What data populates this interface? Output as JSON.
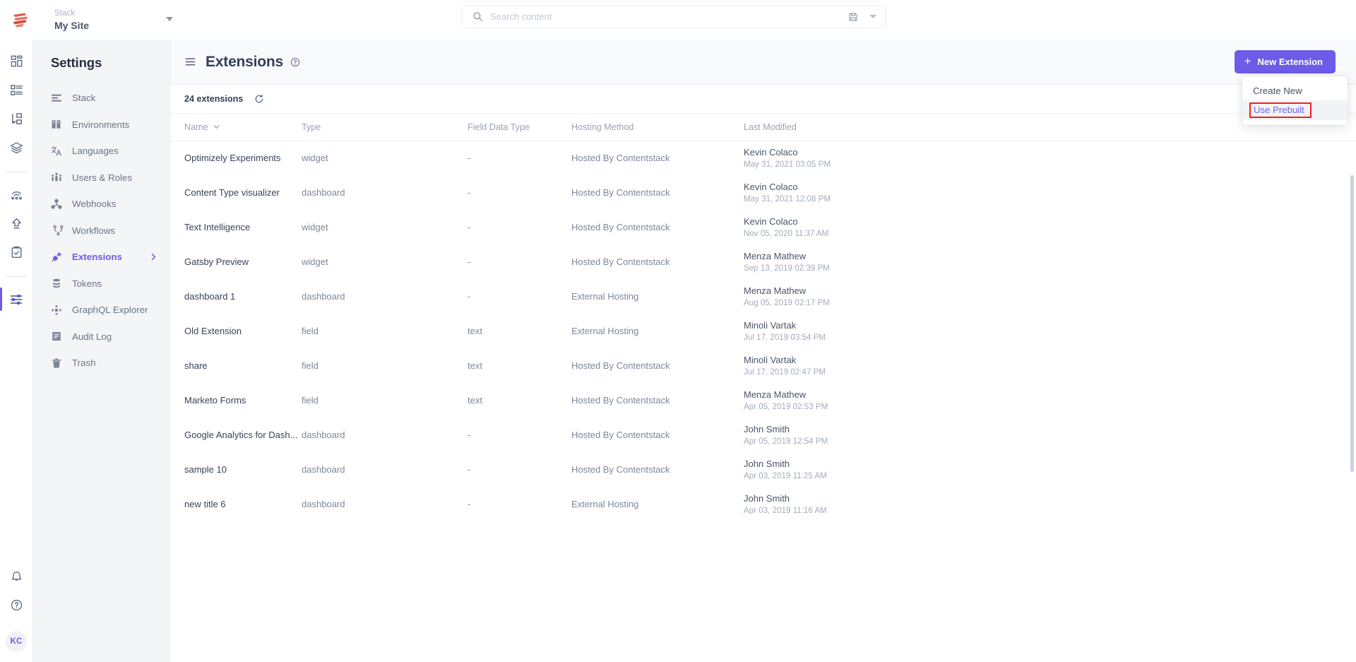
{
  "topbar": {
    "logo_icon": "contentstack-logo-icon",
    "stack_label": "Stack",
    "stack_name": "My Site",
    "search": {
      "placeholder": "Search content",
      "value": "",
      "icon": "search-icon",
      "save_icon": "save-icon",
      "caret_icon": "chevron-down-icon"
    }
  },
  "rail": {
    "items": [
      {
        "name": "dashboard-icon"
      },
      {
        "name": "entries-icon"
      },
      {
        "name": "content-types-icon"
      },
      {
        "name": "assets-icon"
      },
      {
        "name": "releases-icon"
      },
      {
        "name": "publish-queue-icon"
      },
      {
        "name": "bulk-tasks-icon"
      },
      {
        "name": "settings-icon",
        "active": true
      }
    ],
    "bottom": [
      {
        "name": "bell-icon"
      },
      {
        "name": "help-circle-icon"
      }
    ],
    "avatar_initials": "KC"
  },
  "sidebar": {
    "title": "Settings",
    "items": [
      {
        "label": "Stack",
        "icon": "stack-icon",
        "active": false
      },
      {
        "label": "Environments",
        "icon": "environments-icon",
        "active": false
      },
      {
        "label": "Languages",
        "icon": "languages-icon",
        "active": false
      },
      {
        "label": "Users & Roles",
        "icon": "users-roles-icon",
        "active": false
      },
      {
        "label": "Webhooks",
        "icon": "webhooks-icon",
        "active": false
      },
      {
        "label": "Workflows",
        "icon": "workflows-icon",
        "active": false
      },
      {
        "label": "Extensions",
        "icon": "extensions-icon",
        "active": true
      },
      {
        "label": "Tokens",
        "icon": "tokens-icon",
        "active": false
      },
      {
        "label": "GraphQL Explorer",
        "icon": "graphql-icon",
        "active": false
      },
      {
        "label": "Audit Log",
        "icon": "audit-log-icon",
        "active": false
      },
      {
        "label": "Trash",
        "icon": "trash-icon",
        "active": false
      }
    ]
  },
  "page": {
    "menu_icon": "hamburger-icon",
    "title": "Extensions",
    "help_icon": "help-circle-icon",
    "new_button": {
      "label": "New Extension",
      "plus": "+",
      "color": "#6c5ce7"
    },
    "dropdown": {
      "items": [
        {
          "label": "Create New",
          "highlighted": false
        },
        {
          "label": "Use Prebuilt",
          "highlighted": true
        }
      ],
      "highlight_outline_color": "#f2211d"
    }
  },
  "list": {
    "count_text": "24 extensions",
    "refresh_icon": "refresh-icon",
    "columns": [
      {
        "label": "Name",
        "sort_icon": "chevron-down-icon"
      },
      {
        "label": "Type",
        "sort_icon": ""
      },
      {
        "label": "Field Data Type",
        "sort_icon": ""
      },
      {
        "label": "Hosting Method",
        "sort_icon": ""
      },
      {
        "label": "Last Modified",
        "sort_icon": ""
      }
    ],
    "rows": [
      {
        "name": "Optimizely Experiments",
        "type": "widget",
        "field_data_type": "-",
        "hosting_method": "Hosted By Contentstack",
        "modified_by": "Kevin Colaco",
        "modified_at": "May 31, 2021 03:05 PM"
      },
      {
        "name": "Content Type visualizer",
        "type": "dashboard",
        "field_data_type": "-",
        "hosting_method": "Hosted By Contentstack",
        "modified_by": "Kevin Colaco",
        "modified_at": "May 31, 2021 12:08 PM"
      },
      {
        "name": "Text Intelligence",
        "type": "widget",
        "field_data_type": "-",
        "hosting_method": "Hosted By Contentstack",
        "modified_by": "Kevin Colaco",
        "modified_at": "Nov 05, 2020 11:37 AM"
      },
      {
        "name": "Gatsby Preview",
        "type": "widget",
        "field_data_type": "-",
        "hosting_method": "Hosted By Contentstack",
        "modified_by": "Menza Mathew",
        "modified_at": "Sep 13, 2019 02:39 PM"
      },
      {
        "name": "dashboard 1",
        "type": "dashboard",
        "field_data_type": "-",
        "hosting_method": "External Hosting",
        "modified_by": "Menza Mathew",
        "modified_at": "Aug 05, 2019 02:17 PM"
      },
      {
        "name": "Old Extension",
        "type": "field",
        "field_data_type": "text",
        "hosting_method": "External Hosting",
        "modified_by": "Minoli Vartak",
        "modified_at": "Jul 17, 2019 03:54 PM"
      },
      {
        "name": "share",
        "type": "field",
        "field_data_type": "text",
        "hosting_method": "Hosted By Contentstack",
        "modified_by": "Minoli Vartak",
        "modified_at": "Jul 17, 2019 02:47 PM"
      },
      {
        "name": "Marketo Forms",
        "type": "field",
        "field_data_type": "text",
        "hosting_method": "Hosted By Contentstack",
        "modified_by": "Menza Mathew",
        "modified_at": "Apr 05, 2019 02:53 PM"
      },
      {
        "name": "Google Analytics for Dash...",
        "type": "dashboard",
        "field_data_type": "-",
        "hosting_method": "Hosted By Contentstack",
        "modified_by": "John Smith",
        "modified_at": "Apr 05, 2019 12:54 PM"
      },
      {
        "name": "sample 10",
        "type": "dashboard",
        "field_data_type": "-",
        "hosting_method": "Hosted By Contentstack",
        "modified_by": "John Smith",
        "modified_at": "Apr 03, 2019 11:25 AM"
      },
      {
        "name": "new title 6",
        "type": "dashboard",
        "field_data_type": "-",
        "hosting_method": "External Hosting",
        "modified_by": "John Smith",
        "modified_at": "Apr 03, 2019 11:16 AM"
      }
    ]
  },
  "colors": {
    "accent": "#6c5ce7",
    "highlight_red": "#f2211d",
    "sidebar_bg": "#f4f5f7",
    "header_bg": "#f9fafc",
    "text_dark": "#32405a",
    "text_muted": "#7d879b"
  }
}
